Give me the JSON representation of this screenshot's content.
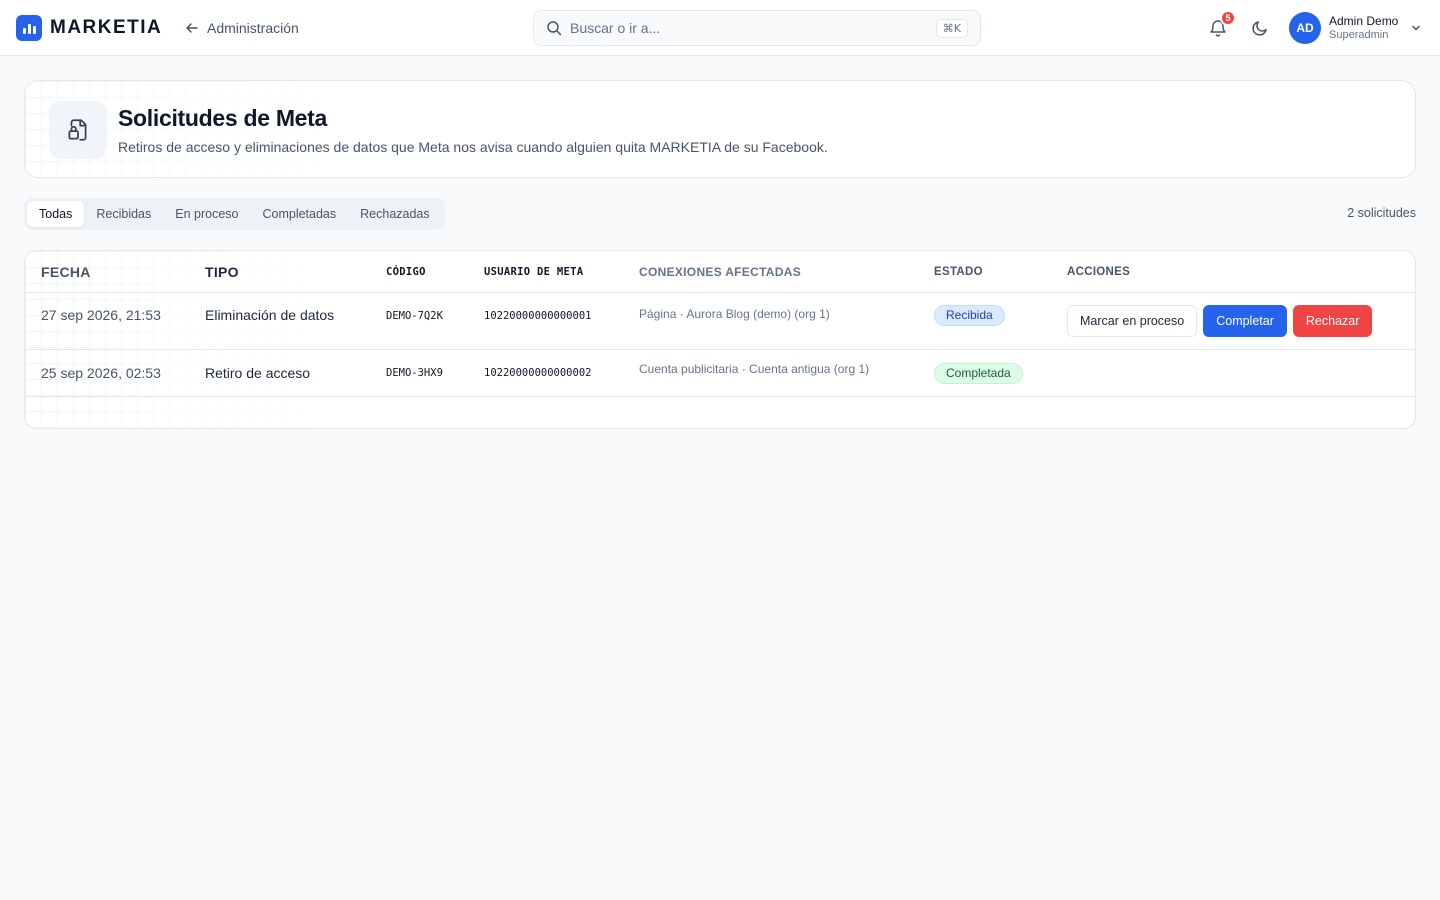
{
  "brand": {
    "name": "MARKETIA",
    "accent": "#2563eb"
  },
  "nav": {
    "back_label": "Administración"
  },
  "search": {
    "placeholder": "Buscar o ir a...",
    "shortcut": "⌘K"
  },
  "notifications": {
    "count": "5"
  },
  "user": {
    "initials": "AD",
    "name": "Admin Demo",
    "role": "Superadmin"
  },
  "page": {
    "title": "Solicitudes de Meta",
    "subtitle": "Retiros de acceso y eliminaciones de datos que Meta nos avisa cuando alguien quita MARKETIA de su Facebook."
  },
  "tabs": [
    {
      "label": "Todas",
      "active": true
    },
    {
      "label": "Recibidas",
      "active": false
    },
    {
      "label": "En proceso",
      "active": false
    },
    {
      "label": "Completadas",
      "active": false
    },
    {
      "label": "Rechazadas",
      "active": false
    }
  ],
  "count_label": "2 solicitudes",
  "table": {
    "headers": [
      "FECHA",
      "TIPO",
      "CÓDIGO",
      "USUARIO DE META",
      "CONEXIONES AFECTADAS",
      "ESTADO",
      "ACCIONES"
    ],
    "rows": [
      {
        "fecha": "27 sep 2026, 21:53",
        "tipo": "Eliminación de datos",
        "codigo": "DEMO-7Q2K",
        "usuario": "10220000000000001",
        "conexiones": "Página · Aurora Blog (demo) (org 1)",
        "estado": "Recibida",
        "actions": {
          "process": "Marcar en proceso",
          "complete": "Completar",
          "reject": "Rechazar"
        }
      },
      {
        "fecha": "25 sep 2026, 02:53",
        "tipo": "Retiro de acceso",
        "codigo": "DEMO-3HX9",
        "usuario": "10220000000000002",
        "conexiones": "Cuenta publicitaria · Cuenta antigua (org 1)",
        "estado": "Completada"
      }
    ]
  },
  "colors": {
    "status_received": "#dbeafe",
    "status_completed": "#dcfce7",
    "primary_button": "#2563eb",
    "danger_button": "#ef4444"
  }
}
